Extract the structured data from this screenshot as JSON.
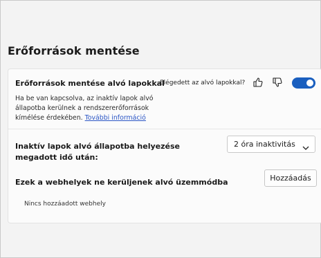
{
  "page": {
    "section_title": "Erőforrások mentése"
  },
  "sleeping_tabs": {
    "title": "Erőforrások mentése alvó lapokkal",
    "description": "Ha be van kapcsolva, az inaktív lapok alvó állapotba kerülnek a rendszererőforrások kímélése érdekében.",
    "more_info_link": "További információ",
    "feedback_label": "Elégedett az alvó lapokkal?",
    "thumbs_up_icon": "thumbs-up-icon",
    "thumbs_down_icon": "thumbs-down-icon",
    "toggle_on": true,
    "accent_color": "#1a5fbf"
  },
  "inactive_timeout": {
    "label": "Inaktív lapok alvó állapotba helyezése megadott idő után:",
    "selected_option": "2 óra inaktivitás",
    "chevron_icon": "chevron-down-icon"
  },
  "never_sleep_sites": {
    "label": "Ezek a webhelyek ne kerüljenek alvó üzemmódba",
    "add_button": "Hozzáadás",
    "empty_text": "Nincs hozzáadott webhely"
  }
}
